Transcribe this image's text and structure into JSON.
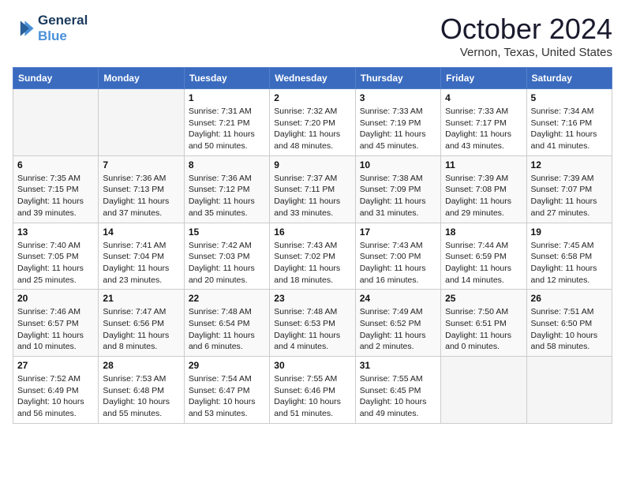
{
  "header": {
    "logo_line1": "General",
    "logo_line2": "Blue",
    "title": "October 2024",
    "location": "Vernon, Texas, United States"
  },
  "days": [
    "Sunday",
    "Monday",
    "Tuesday",
    "Wednesday",
    "Thursday",
    "Friday",
    "Saturday"
  ],
  "weeks": [
    [
      {
        "date": "",
        "sunrise": "",
        "sunset": "",
        "daylight": ""
      },
      {
        "date": "",
        "sunrise": "",
        "sunset": "",
        "daylight": ""
      },
      {
        "date": "1",
        "sunrise": "Sunrise: 7:31 AM",
        "sunset": "Sunset: 7:21 PM",
        "daylight": "Daylight: 11 hours and 50 minutes."
      },
      {
        "date": "2",
        "sunrise": "Sunrise: 7:32 AM",
        "sunset": "Sunset: 7:20 PM",
        "daylight": "Daylight: 11 hours and 48 minutes."
      },
      {
        "date": "3",
        "sunrise": "Sunrise: 7:33 AM",
        "sunset": "Sunset: 7:19 PM",
        "daylight": "Daylight: 11 hours and 45 minutes."
      },
      {
        "date": "4",
        "sunrise": "Sunrise: 7:33 AM",
        "sunset": "Sunset: 7:17 PM",
        "daylight": "Daylight: 11 hours and 43 minutes."
      },
      {
        "date": "5",
        "sunrise": "Sunrise: 7:34 AM",
        "sunset": "Sunset: 7:16 PM",
        "daylight": "Daylight: 11 hours and 41 minutes."
      }
    ],
    [
      {
        "date": "6",
        "sunrise": "Sunrise: 7:35 AM",
        "sunset": "Sunset: 7:15 PM",
        "daylight": "Daylight: 11 hours and 39 minutes."
      },
      {
        "date": "7",
        "sunrise": "Sunrise: 7:36 AM",
        "sunset": "Sunset: 7:13 PM",
        "daylight": "Daylight: 11 hours and 37 minutes."
      },
      {
        "date": "8",
        "sunrise": "Sunrise: 7:36 AM",
        "sunset": "Sunset: 7:12 PM",
        "daylight": "Daylight: 11 hours and 35 minutes."
      },
      {
        "date": "9",
        "sunrise": "Sunrise: 7:37 AM",
        "sunset": "Sunset: 7:11 PM",
        "daylight": "Daylight: 11 hours and 33 minutes."
      },
      {
        "date": "10",
        "sunrise": "Sunrise: 7:38 AM",
        "sunset": "Sunset: 7:09 PM",
        "daylight": "Daylight: 11 hours and 31 minutes."
      },
      {
        "date": "11",
        "sunrise": "Sunrise: 7:39 AM",
        "sunset": "Sunset: 7:08 PM",
        "daylight": "Daylight: 11 hours and 29 minutes."
      },
      {
        "date": "12",
        "sunrise": "Sunrise: 7:39 AM",
        "sunset": "Sunset: 7:07 PM",
        "daylight": "Daylight: 11 hours and 27 minutes."
      }
    ],
    [
      {
        "date": "13",
        "sunrise": "Sunrise: 7:40 AM",
        "sunset": "Sunset: 7:05 PM",
        "daylight": "Daylight: 11 hours and 25 minutes."
      },
      {
        "date": "14",
        "sunrise": "Sunrise: 7:41 AM",
        "sunset": "Sunset: 7:04 PM",
        "daylight": "Daylight: 11 hours and 23 minutes."
      },
      {
        "date": "15",
        "sunrise": "Sunrise: 7:42 AM",
        "sunset": "Sunset: 7:03 PM",
        "daylight": "Daylight: 11 hours and 20 minutes."
      },
      {
        "date": "16",
        "sunrise": "Sunrise: 7:43 AM",
        "sunset": "Sunset: 7:02 PM",
        "daylight": "Daylight: 11 hours and 18 minutes."
      },
      {
        "date": "17",
        "sunrise": "Sunrise: 7:43 AM",
        "sunset": "Sunset: 7:00 PM",
        "daylight": "Daylight: 11 hours and 16 minutes."
      },
      {
        "date": "18",
        "sunrise": "Sunrise: 7:44 AM",
        "sunset": "Sunset: 6:59 PM",
        "daylight": "Daylight: 11 hours and 14 minutes."
      },
      {
        "date": "19",
        "sunrise": "Sunrise: 7:45 AM",
        "sunset": "Sunset: 6:58 PM",
        "daylight": "Daylight: 11 hours and 12 minutes."
      }
    ],
    [
      {
        "date": "20",
        "sunrise": "Sunrise: 7:46 AM",
        "sunset": "Sunset: 6:57 PM",
        "daylight": "Daylight: 11 hours and 10 minutes."
      },
      {
        "date": "21",
        "sunrise": "Sunrise: 7:47 AM",
        "sunset": "Sunset: 6:56 PM",
        "daylight": "Daylight: 11 hours and 8 minutes."
      },
      {
        "date": "22",
        "sunrise": "Sunrise: 7:48 AM",
        "sunset": "Sunset: 6:54 PM",
        "daylight": "Daylight: 11 hours and 6 minutes."
      },
      {
        "date": "23",
        "sunrise": "Sunrise: 7:48 AM",
        "sunset": "Sunset: 6:53 PM",
        "daylight": "Daylight: 11 hours and 4 minutes."
      },
      {
        "date": "24",
        "sunrise": "Sunrise: 7:49 AM",
        "sunset": "Sunset: 6:52 PM",
        "daylight": "Daylight: 11 hours and 2 minutes."
      },
      {
        "date": "25",
        "sunrise": "Sunrise: 7:50 AM",
        "sunset": "Sunset: 6:51 PM",
        "daylight": "Daylight: 11 hours and 0 minutes."
      },
      {
        "date": "26",
        "sunrise": "Sunrise: 7:51 AM",
        "sunset": "Sunset: 6:50 PM",
        "daylight": "Daylight: 10 hours and 58 minutes."
      }
    ],
    [
      {
        "date": "27",
        "sunrise": "Sunrise: 7:52 AM",
        "sunset": "Sunset: 6:49 PM",
        "daylight": "Daylight: 10 hours and 56 minutes."
      },
      {
        "date": "28",
        "sunrise": "Sunrise: 7:53 AM",
        "sunset": "Sunset: 6:48 PM",
        "daylight": "Daylight: 10 hours and 55 minutes."
      },
      {
        "date": "29",
        "sunrise": "Sunrise: 7:54 AM",
        "sunset": "Sunset: 6:47 PM",
        "daylight": "Daylight: 10 hours and 53 minutes."
      },
      {
        "date": "30",
        "sunrise": "Sunrise: 7:55 AM",
        "sunset": "Sunset: 6:46 PM",
        "daylight": "Daylight: 10 hours and 51 minutes."
      },
      {
        "date": "31",
        "sunrise": "Sunrise: 7:55 AM",
        "sunset": "Sunset: 6:45 PM",
        "daylight": "Daylight: 10 hours and 49 minutes."
      },
      {
        "date": "",
        "sunrise": "",
        "sunset": "",
        "daylight": ""
      },
      {
        "date": "",
        "sunrise": "",
        "sunset": "",
        "daylight": ""
      }
    ]
  ]
}
